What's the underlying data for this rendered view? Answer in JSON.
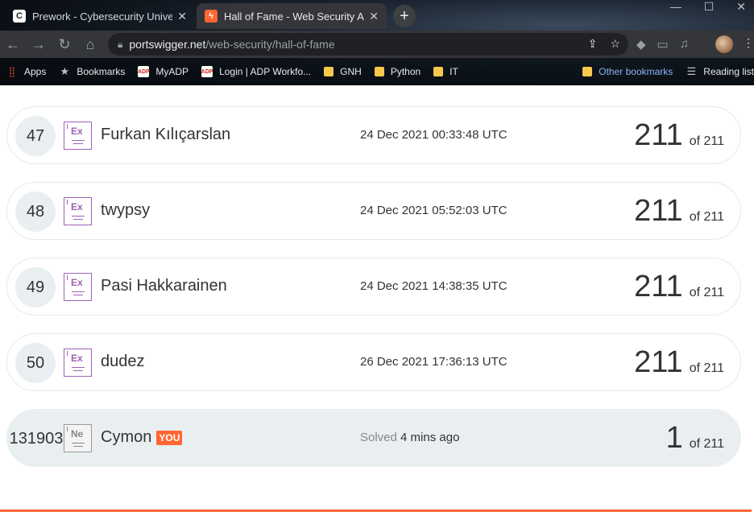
{
  "browser": {
    "tabs": [
      {
        "title": "Prework - Cybersecurity Universit",
        "icon": "codepath-icon"
      },
      {
        "title": "Hall of Fame - Web Security Acad",
        "icon": "portswigger-icon"
      }
    ],
    "url_host": "portswigger.net",
    "url_path": "/web-security/hall-of-fame",
    "bookmarks": [
      {
        "label": "Apps",
        "icon": "apps-grid-icon"
      },
      {
        "label": "Bookmarks",
        "icon": "star-icon"
      },
      {
        "label": "MyADP",
        "icon": "adp-icon"
      },
      {
        "label": "Login | ADP Workfo...",
        "icon": "adp-icon"
      },
      {
        "label": "GNH",
        "icon": "folder-icon"
      },
      {
        "label": "Python",
        "icon": "folder-icon"
      },
      {
        "label": "IT",
        "icon": "folder-icon"
      }
    ],
    "other_bookmarks": "Other bookmarks",
    "reading_list": "Reading list"
  },
  "colors": {
    "accent": "#ff6633",
    "expert_badge": "#a060b8",
    "row_highlight": "#e9eef1"
  },
  "leaderboard": {
    "rows": [
      {
        "rank": "47",
        "badge": "Ex",
        "name": "Furkan Kılıçarslan",
        "time": "24 Dec 2021 00:33:48 UTC",
        "score": "211",
        "total": "of 211"
      },
      {
        "rank": "48",
        "badge": "Ex",
        "name": "twypsy",
        "time": "24 Dec 2021 05:52:03 UTC",
        "score": "211",
        "total": "of 211"
      },
      {
        "rank": "49",
        "badge": "Ex",
        "name": "Pasi Hakkarainen",
        "time": "24 Dec 2021 14:38:35 UTC",
        "score": "211",
        "total": "of 211"
      },
      {
        "rank": "50",
        "badge": "Ex",
        "name": "dudez",
        "time": "26 Dec 2021 17:36:13 UTC",
        "score": "211",
        "total": "of 211"
      }
    ],
    "me": {
      "rank": "131903",
      "badge": "Ne",
      "name": "Cymon",
      "you_label": "YOU",
      "solved_prefix": "Solved",
      "solved_time": "4 mins ago",
      "score": "1",
      "total": "of 211"
    }
  }
}
